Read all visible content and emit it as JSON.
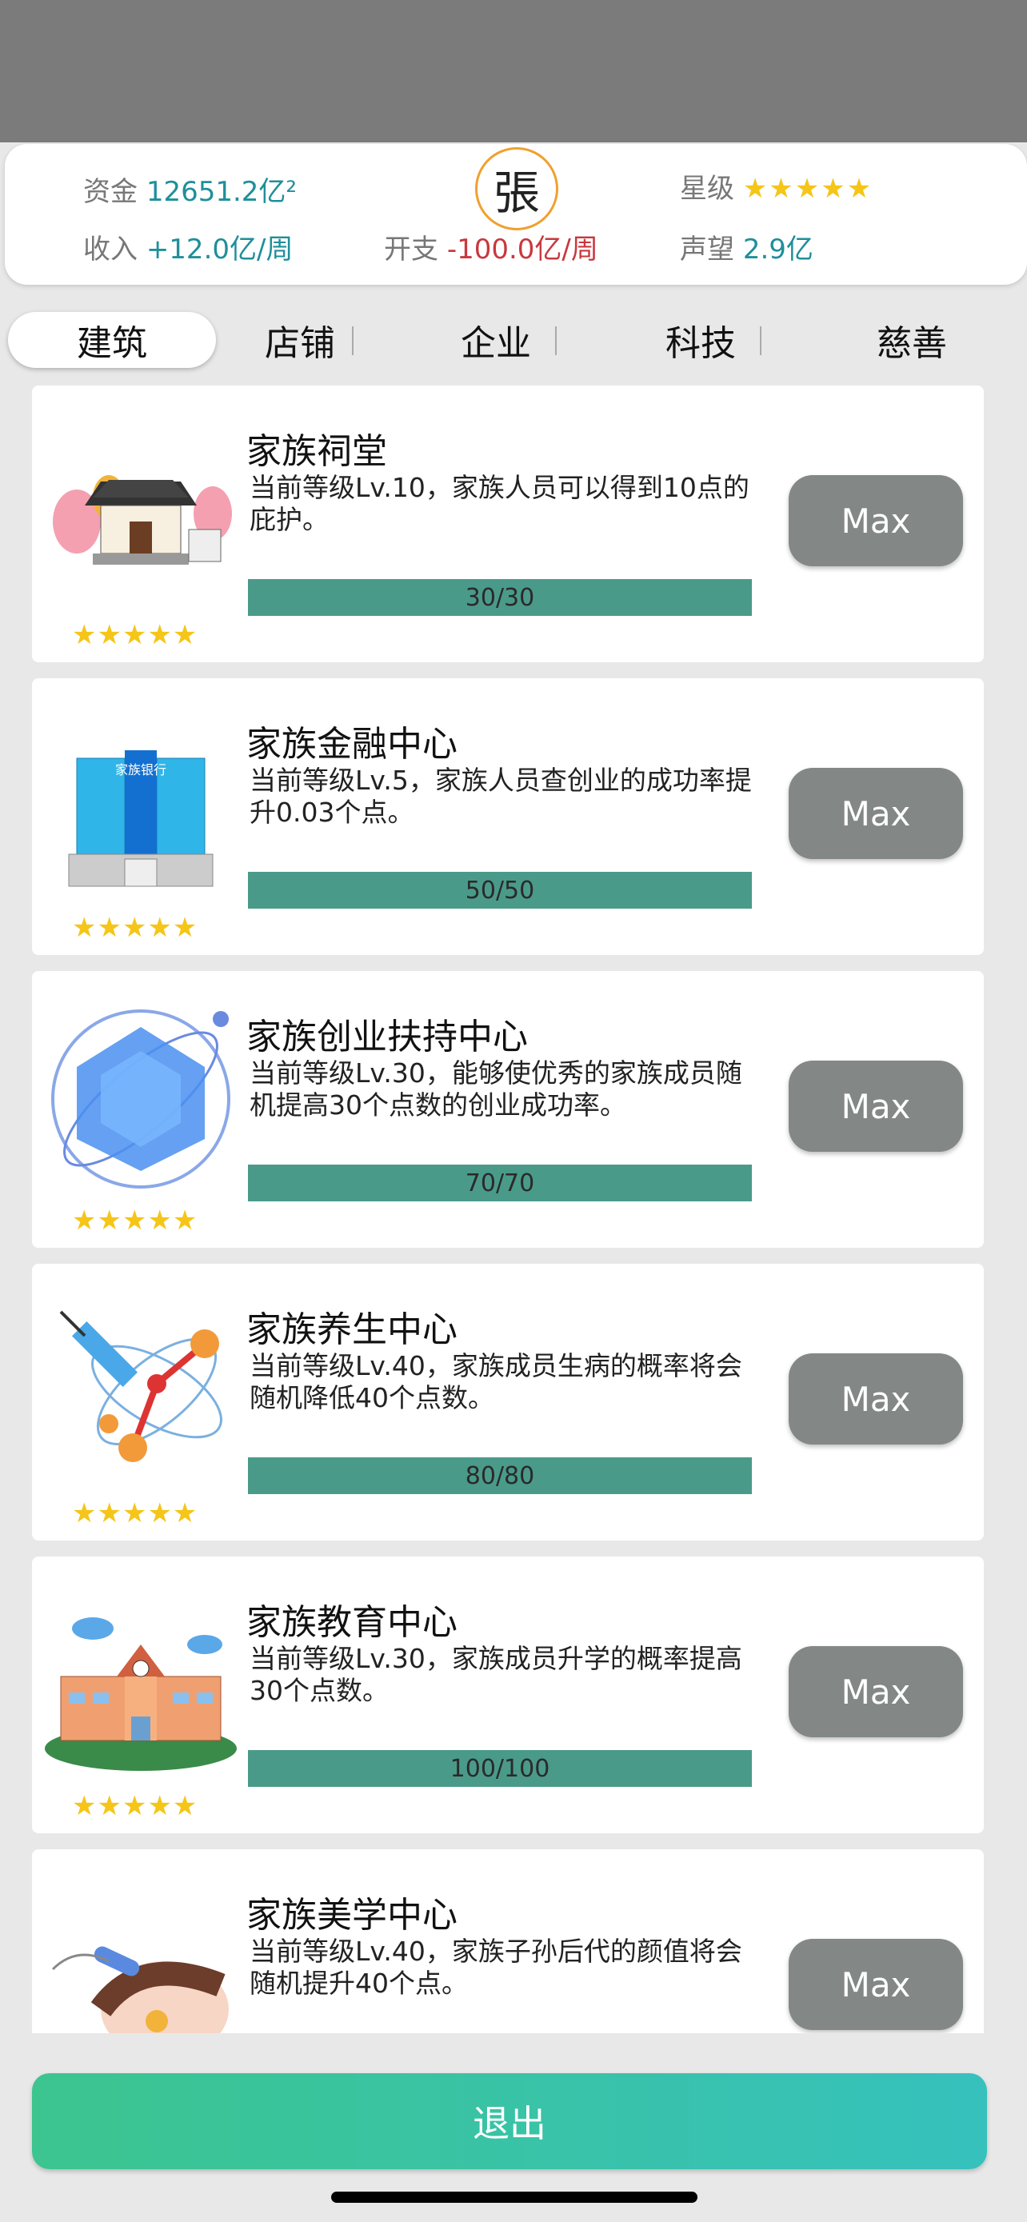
{
  "header": {
    "funds_label": "资金",
    "funds_value": "12651.2亿²",
    "income_label": "收入",
    "income_value": "+12.0亿/周",
    "expense_label": "开支",
    "expense_value": "-100.0亿/周",
    "star_label": "星级",
    "star_value": "★★★★★",
    "fame_label": "声望",
    "fame_value": "2.9亿",
    "emblem": "張"
  },
  "tabs": [
    {
      "label": "建筑",
      "active": true
    },
    {
      "label": "店铺"
    },
    {
      "label": "企业"
    },
    {
      "label": "科技"
    },
    {
      "label": "慈善"
    }
  ],
  "cards": [
    {
      "title": "家族祠堂",
      "desc": "当前等级Lv.10，家族人员可以得到10点的庇护。",
      "progress": "30/30",
      "progress_fraction": 1.0,
      "button": "Max",
      "stars": "★★★★★",
      "icon": "ancestral-hall-icon"
    },
    {
      "title": "家族金融中心",
      "desc": "当前等级Lv.5，家族人员查创业的成功率提升0.03个点。",
      "progress": "50/50",
      "progress_fraction": 1.0,
      "button": "Max",
      "stars": "★★★★★",
      "icon": "bank-building-icon",
      "sign": "家族银行"
    },
    {
      "title": "家族创业扶持中心",
      "desc": "当前等级Lv.30，能够使优秀的家族成员随机提高30个点数的创业成功率。",
      "progress": "70/70",
      "progress_fraction": 1.0,
      "button": "Max",
      "stars": "★★★★★",
      "icon": "crystal-orbit-icon"
    },
    {
      "title": "家族养生中心",
      "desc": "当前等级Lv.40，家族成员生病的概率将会随机降低40个点数。",
      "progress": "80/80",
      "progress_fraction": 1.0,
      "button": "Max",
      "stars": "★★★★★",
      "icon": "syringe-molecule-icon"
    },
    {
      "title": "家族教育中心",
      "desc": "当前等级Lv.30，家族成员升学的概率提高30个点数。",
      "progress": "100/100",
      "progress_fraction": 1.0,
      "button": "Max",
      "stars": "★★★★★",
      "icon": "school-building-icon"
    },
    {
      "title": "家族美学中心",
      "desc": "当前等级Lv.40，家族子孙后代的颜值将会随机提升40个点。",
      "button": "Max",
      "icon": "beauty-treatment-icon"
    }
  ],
  "footer": {
    "exit_label": "退出"
  },
  "colors": {
    "teal": "#1f8f9a",
    "red": "#c8383e",
    "bar": "#4a9a8a",
    "button": "#838887",
    "exit_from": "#3cc58f",
    "exit_to": "#36c1bd"
  }
}
